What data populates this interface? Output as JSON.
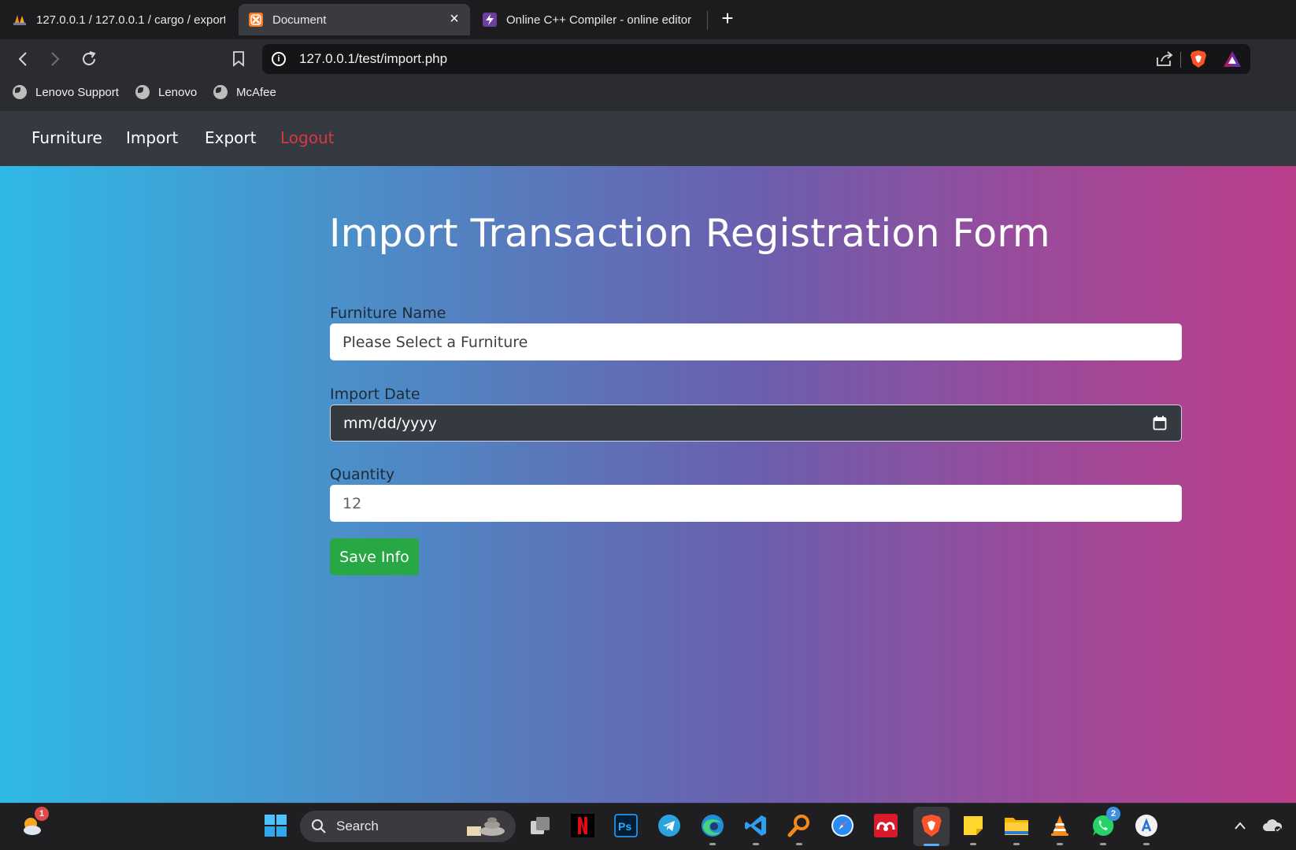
{
  "browser": {
    "tabs": [
      {
        "title": "127.0.0.1 / 127.0.0.1 / cargo / exports",
        "icon": "phpmyadmin-icon"
      },
      {
        "title": "Document",
        "icon": "xampp-icon",
        "active": true
      },
      {
        "title": "Online C++ Compiler - online editor",
        "icon": "compiler-icon"
      }
    ],
    "new_tab": "+",
    "close": "×",
    "url": "127.0.0.1/test/import.php",
    "bookmarks": [
      "Lenovo Support",
      "Lenovo",
      "McAfee"
    ]
  },
  "site_nav": {
    "items": [
      "Furniture",
      "Import",
      "Export"
    ],
    "logout": "Logout",
    "logout_color": "#dc3545"
  },
  "form": {
    "title": "Import Transaction Registration Form",
    "furniture_label": "Furniture Name",
    "furniture_value": "Please Select a Furniture",
    "date_label": "Import Date",
    "date_value": "mm/dd/yyyy",
    "quantity_label": "Quantity",
    "quantity_value": "12",
    "save_label": "Save Info",
    "save_color": "#28a745"
  },
  "taskbar": {
    "search": "Search",
    "weather_badge": "1",
    "whatsapp_badge": "2"
  }
}
